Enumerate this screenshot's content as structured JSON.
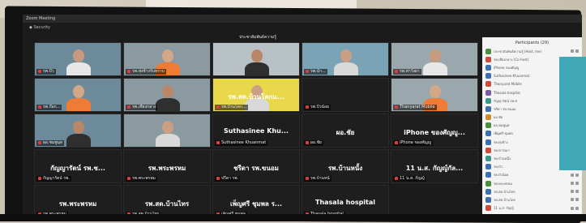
{
  "window": {
    "title": "Zoom Meeting",
    "security_label": "Security",
    "view_label": "ประชาสัมพันธ์ความรู้"
  },
  "panel": {
    "title": "Participants (29)"
  },
  "tiles": [
    {
      "name": "รพ.ปัว",
      "kind": "video",
      "big": ""
    },
    {
      "name": "รพ.ทุ่งช้างรับทราบ",
      "kind": "video",
      "big": ""
    },
    {
      "name": "",
      "kind": "video",
      "big": ""
    },
    {
      "name": "รพ.น้ำ...",
      "kind": "video",
      "big": ""
    },
    {
      "name": "รพ.ท่าวังผา",
      "kind": "video",
      "big": ""
    },
    {
      "name": "รพ.ก๊อก...",
      "kind": "video",
      "big": ""
    },
    {
      "name": "รพ.เชียงกลาง",
      "kind": "video",
      "big": ""
    },
    {
      "name": "รพ.บ้านโคก...",
      "kind": "video",
      "big": "รพ.สต.บ้านโคกแ..."
    },
    {
      "name": "รพ.ปัวน้อย",
      "kind": "dark",
      "big": ""
    },
    {
      "name": "Thanyarat Mobile",
      "kind": "video",
      "big": ""
    },
    {
      "name": "ผอ.ชมพูนุท",
      "kind": "video",
      "big": ""
    },
    {
      "name": "",
      "kind": "video",
      "big": ""
    },
    {
      "name": "Suthasinee Khuanmat",
      "kind": "dark",
      "big": "Suthasinee Khu..."
    },
    {
      "name": "ผอ.ชัย",
      "kind": "dark",
      "big": "ผอ.ชัย"
    },
    {
      "name": "iPhone ของศัญญู",
      "kind": "dark",
      "big": "iPhone ของศัญญู..."
    },
    {
      "name": "กัญญารัตน์ รพ.",
      "kind": "dark",
      "big": "กัญญารัตน์ รพ.ช..."
    },
    {
      "name": "รพ.พระพรหม",
      "kind": "dark",
      "big": "รพ.พระพรหม"
    },
    {
      "name": "ปรีดา รพ.",
      "kind": "dark",
      "big": "ชรีดา รพ.ขนอม"
    },
    {
      "name": "รพ.บ้านหนั",
      "kind": "dark",
      "big": "รพ.บ้านหนั้ง"
    },
    {
      "name": "11 น.ส. กัญญ์",
      "kind": "dark",
      "big": "11 น.ส. กัญญ์กัล..."
    },
    {
      "name": "รพ.พระพรหม",
      "kind": "dark",
      "big": "รพ.พระพรหม"
    },
    {
      "name": "รพ.สต.บ้านไทร",
      "kind": "dark",
      "big": "รพ.สต.บ้านไทร"
    },
    {
      "name": "เพ็ญศรี ชุมพล",
      "kind": "dark",
      "big": "เพ็ญศรี ชุมพล ร..."
    },
    {
      "name": "Thasala hospital",
      "kind": "dark",
      "big": "Thasala hospital"
    }
  ],
  "participants": [
    {
      "name": "ประชาสัมพันธ์ความรู้ (Host, me)",
      "color": "#4a8f3c"
    },
    {
      "name": "รพ.เชียงกลาง (Co-host)",
      "color": "#d04a3a"
    },
    {
      "name": "iPhone ของศัญญู",
      "color": "#3a6fb5"
    },
    {
      "name": "Suthasinee Khuanmat",
      "color": "#3a6fb5"
    },
    {
      "name": "Thanyarat Mobile",
      "color": "#d04a3a"
    },
    {
      "name": "Thasala hospital",
      "color": "#7a5ab0"
    },
    {
      "name": "กัญญารัตน์ รพ.ช",
      "color": "#3a9a8a"
    },
    {
      "name": "ชรีดา รพ.ขนอม",
      "color": "#3a6fb5"
    },
    {
      "name": "ผอ.ชัย",
      "color": "#d08a2a"
    },
    {
      "name": "ผอ.ชมพูนุท",
      "color": "#4a8f3c"
    },
    {
      "name": "เพ็ญศรี ชุมพล",
      "color": "#3a6fb5"
    },
    {
      "name": "รพ.ทุ่งช้าง",
      "color": "#3a6fb5"
    },
    {
      "name": "รพ.ท่าวังผา",
      "color": "#d04a3a"
    },
    {
      "name": "รพ.บ้านหนั้ง",
      "color": "#3a9a8a"
    },
    {
      "name": "รพ.ปัว",
      "color": "#3a6fb5"
    },
    {
      "name": "รพ.ปัวน้อย",
      "color": "#3a6fb5"
    },
    {
      "name": "รพ.พระพรหม",
      "color": "#4a8f3c"
    },
    {
      "name": "รพ.สต.บ้านไทร",
      "color": "#3a6fb5"
    },
    {
      "name": "รพ.สต.บ้านโคก",
      "color": "#3a6fb5"
    },
    {
      "name": "11 น.ส. กัญญ์",
      "color": "#d04a3a"
    }
  ]
}
